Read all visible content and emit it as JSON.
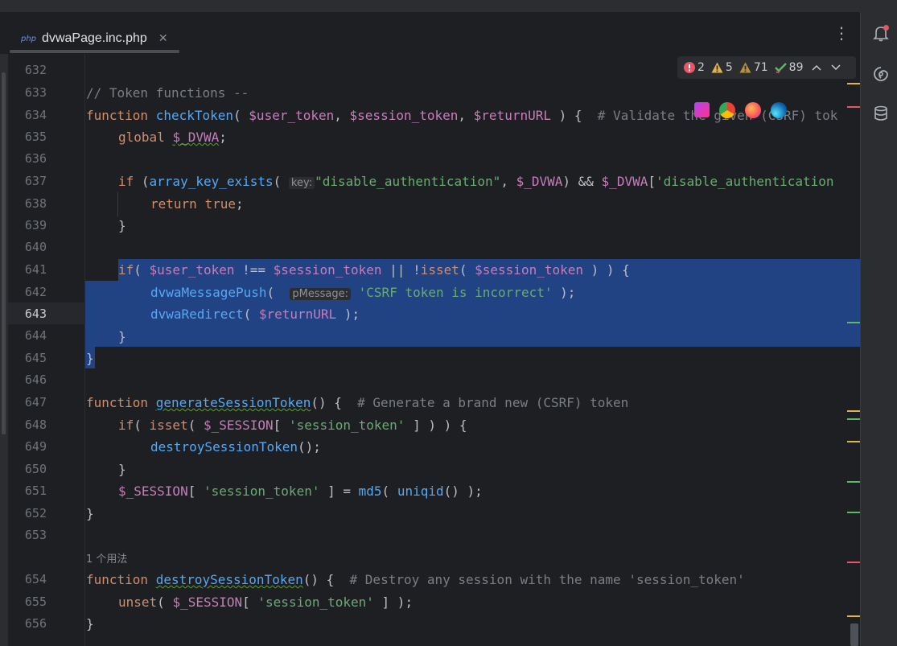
{
  "editor_tab": {
    "file_type_badge": "php",
    "file_name": "dvwaPage.inc.php",
    "close_glyph": "✕"
  },
  "tab_menu_glyph": "⋮",
  "inspections": {
    "errors": "2",
    "warnings": "5",
    "weak_warnings": "71",
    "ok": "89"
  },
  "line_numbers": [
    "632",
    "633",
    "634",
    "635",
    "636",
    "637",
    "638",
    "639",
    "640",
    "641",
    "642",
    "643",
    "644",
    "645",
    "646",
    "647",
    "648",
    "649",
    "650",
    "651",
    "652",
    "653",
    "654",
    "655",
    "656"
  ],
  "current_line": "643",
  "code": {
    "l633": "// Token functions --",
    "l634_kw": "function",
    "l634_fn": "checkToken",
    "l634_p1": "$user_token",
    "l634_p2": "$session_token",
    "l634_p3": "$returnURL",
    "l634_cm": "# Validate the given (CSRF) tok",
    "l635_kw": "global",
    "l635_var": "$_DVWA",
    "l637_kw": "if",
    "l637_fn": "array_key_exists",
    "l637_hint": "key:",
    "l637_str": "\"disable_authentication\"",
    "l637_var": "$_DVWA",
    "l637_var2": "$_DVWA",
    "l637_str2": "'disable_authentication",
    "l638_kw": "return",
    "l638_val": "true",
    "l641_kw": "if",
    "l641_v1": "$user_token",
    "l641_v2": "$session_token",
    "l641_fn": "isset",
    "l641_v3": "$session_token",
    "l642_fn": "dvwaMessagePush",
    "l642_hint": "pMessage:",
    "l642_str": "'CSRF token is incorrect'",
    "l643_fn": "dvwaRedirect",
    "l643_var": "$returnURL",
    "l647_kw": "function",
    "l647_fn": "generateSessionToken",
    "l647_cm": "# Generate a brand new (CSRF) token",
    "l648_kw": "if",
    "l648_fn": "isset",
    "l648_var": "$_SESSION",
    "l648_str": "'session_token'",
    "l649_fn": "destroySessionToken",
    "l651_var": "$_SESSION",
    "l651_str": "'session_token'",
    "l651_fn1": "md5",
    "l651_fn2": "uniqid",
    "usage": "1 个用法",
    "l654_kw": "function",
    "l654_fn": "destroySessionToken",
    "l654_cm": "# Destroy any session with the name 'session_token'",
    "l655_fn": "unset",
    "l655_var": "$_SESSION",
    "l655_str": "'session_token'"
  },
  "colors": {
    "selection": "#214283",
    "error": "#e55765",
    "warning": "#e0b44a",
    "ok": "#5fb865"
  }
}
